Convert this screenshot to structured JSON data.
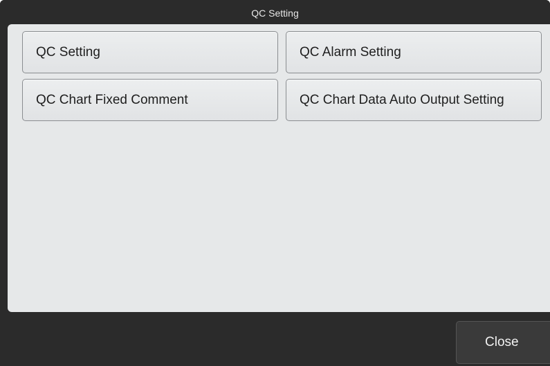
{
  "window": {
    "title": "QC Setting"
  },
  "menu": {
    "buttons": [
      {
        "label": "QC Setting"
      },
      {
        "label": "QC Alarm Setting"
      },
      {
        "label": "QC Chart Fixed Comment"
      },
      {
        "label": "QC Chart Data Auto Output Setting"
      }
    ]
  },
  "footer": {
    "close_label": "Close"
  },
  "colors": {
    "frame": "#2b2b2b",
    "panel": "#e6e8e9",
    "button_border": "#8a8d90"
  }
}
